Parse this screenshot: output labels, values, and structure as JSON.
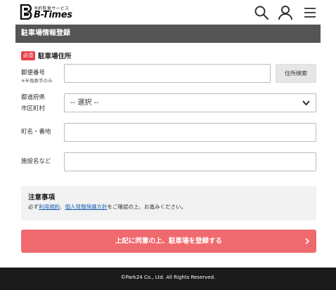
{
  "header": {
    "logo_sub": "予約駐車サービス",
    "logo_text": "B-Times",
    "icons": [
      "search-icon",
      "user-icon",
      "menu-icon"
    ]
  },
  "section": {
    "title": "駐車場情報登録"
  },
  "address": {
    "required_badge": "必須",
    "heading": "駐車場住所",
    "postal_label": "郵便番号",
    "postal_note": "※半角数字のみ",
    "postal_value": "",
    "lookup_button": "住所検索",
    "pref_label_1": "都道府県",
    "pref_label_2": "市区町村",
    "select_value": "-- 選択 --",
    "town_label": "町名・番地",
    "town_value": "",
    "facility_label": "施設名など",
    "facility_value": ""
  },
  "notice": {
    "title": "注意事項",
    "text_1": "必ず",
    "link_terms": "利用規約",
    "text_2": "、",
    "link_privacy": "個人情報保護方針",
    "text_3": "をご確認の上、お進みください。"
  },
  "submit": {
    "label": "上記に同意の上、駐車場を登録する"
  },
  "footer": {
    "copyright": "©Park24 Co., Ltd. All Rights Reserved."
  },
  "colors": {
    "section_bar": "#555555",
    "required": "#e8414e",
    "submit": "#ef6a6e",
    "link": "#1a5fb4",
    "footer": "#1a1a1a"
  }
}
